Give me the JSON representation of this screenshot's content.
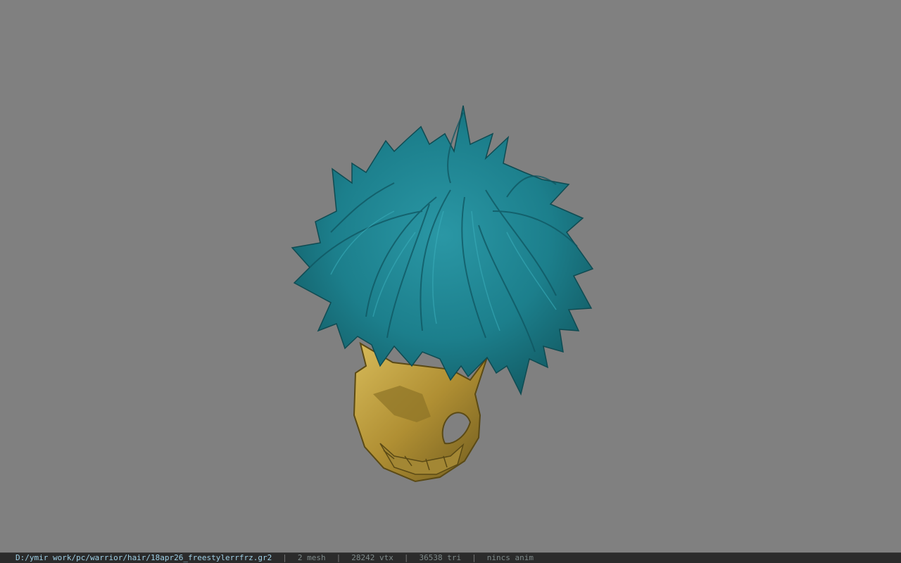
{
  "viewport": {
    "background_color": "#808080",
    "model": {
      "hair_color": "#1e7e8a",
      "mask_color": "#b89a3a"
    }
  },
  "status_bar": {
    "file_path": "D:/ymir work/pc/warrior/hair/18apr26_freestylerrfrz.gr2",
    "separator": "|",
    "mesh_count": "2 mesh",
    "vertex_count": "28242 vtx",
    "triangle_count": "36538 tri",
    "anim_status": "nincs anim"
  }
}
